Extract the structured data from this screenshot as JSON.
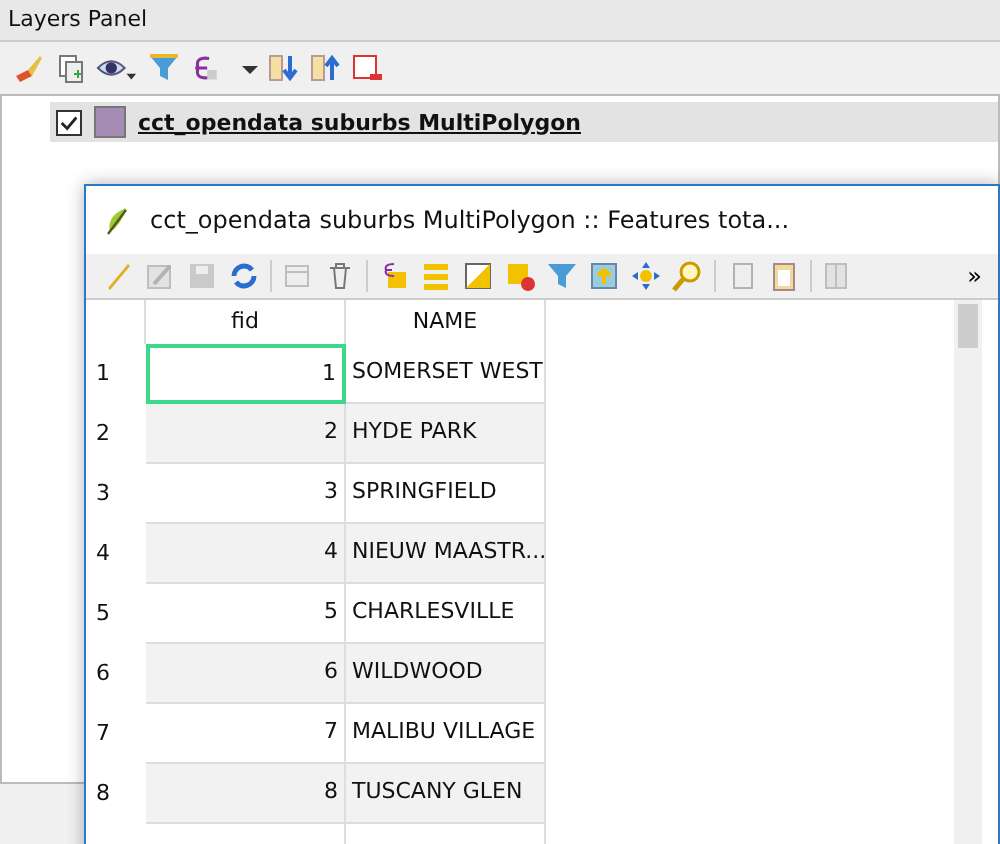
{
  "layers_panel": {
    "title": "Layers Panel",
    "layers": [
      {
        "name": "cct_opendata suburbs MultiPolygon",
        "checked": true,
        "color": "#a58cb5"
      }
    ]
  },
  "attribute_window": {
    "title": "cct_opendata suburbs MultiPolygon :: Features tota...",
    "overflow_button": "»",
    "table": {
      "columns": [
        "fid",
        "NAME"
      ],
      "rows": [
        {
          "header": "1",
          "cells": [
            "1",
            "SOMERSET WEST"
          ],
          "current": true
        },
        {
          "header": "2",
          "cells": [
            "2",
            "HYDE PARK"
          ],
          "current": false
        },
        {
          "header": "3",
          "cells": [
            "3",
            "SPRINGFIELD"
          ],
          "current": false
        },
        {
          "header": "4",
          "cells": [
            "4",
            "NIEUW MAASTR..."
          ],
          "current": false
        },
        {
          "header": "5",
          "cells": [
            "5",
            "CHARLESVILLE"
          ],
          "current": false
        },
        {
          "header": "6",
          "cells": [
            "6",
            "WILDWOOD"
          ],
          "current": false
        },
        {
          "header": "7",
          "cells": [
            "7",
            "MALIBU VILLAGE"
          ],
          "current": false
        },
        {
          "header": "8",
          "cells": [
            "8",
            "TUSCANY GLEN"
          ],
          "current": false
        }
      ]
    }
  }
}
